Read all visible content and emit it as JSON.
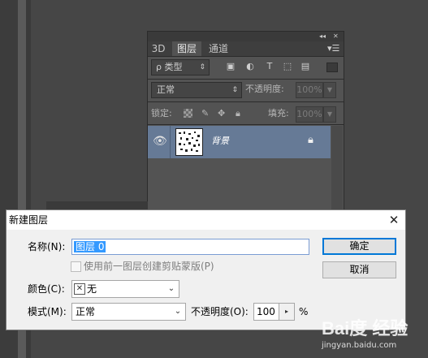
{
  "layers_panel": {
    "tabs": [
      {
        "label": "3D"
      },
      {
        "label": "图层"
      },
      {
        "label": "通道"
      }
    ],
    "filter_label": "ρ 类型",
    "filter_icons": [
      "image-icon",
      "adjustment-circle-icon",
      "text-T-icon",
      "shape-icon",
      "smart-object-icon"
    ],
    "blend_mode": "正常",
    "opacity_label": "不透明度:",
    "opacity_value": "100%",
    "lock_label": "锁定:",
    "fill_label": "填充:",
    "fill_value": "100%",
    "layers": [
      {
        "name": "背景",
        "visible": true,
        "locked": true
      }
    ]
  },
  "dialog": {
    "title": "新建图层",
    "name_label": "名称(N):",
    "name_value": "图层 0",
    "clip_checkbox_label": "使用前一图层创建剪贴蒙版(P)",
    "color_label": "颜色(C):",
    "color_value": "无",
    "mode_label": "模式(M):",
    "mode_value": "正常",
    "opacity_label": "不透明度(O):",
    "opacity_value": "100",
    "opacity_unit": "%",
    "ok_button": "确定",
    "cancel_button": "取消"
  },
  "watermark": {
    "brand": "Bai度 经验",
    "url": "jingyan.baidu.com"
  },
  "colors": {
    "workspace_bg": "#464646",
    "panel_bg": "#535353",
    "selected_layer": "#667a96",
    "dialog_bg": "#f0f0f0",
    "selection_blue": "#3399ff"
  }
}
